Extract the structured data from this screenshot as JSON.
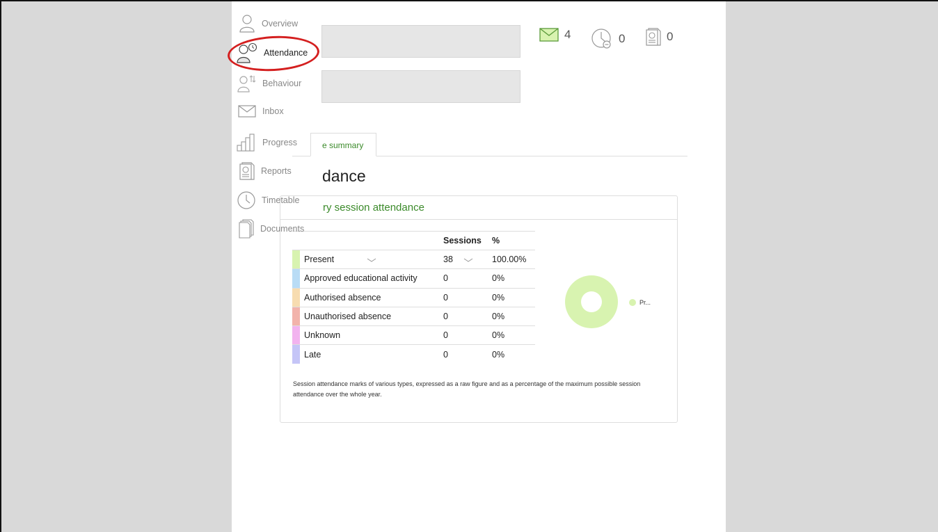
{
  "nav": {
    "items": [
      {
        "label": "Overview",
        "icon": "person-icon"
      },
      {
        "label": "Attendance",
        "icon": "person-clock-icon",
        "active": true
      },
      {
        "label": "Behaviour",
        "icon": "person-arrows-icon"
      },
      {
        "label": "Inbox",
        "icon": "envelope-icon"
      },
      {
        "label": "Progress",
        "icon": "bar-chart-icon"
      },
      {
        "label": "Reports",
        "icon": "report-icon"
      },
      {
        "label": "Timetable",
        "icon": "clock-icon"
      },
      {
        "label": "Documents",
        "icon": "documents-icon"
      }
    ]
  },
  "counters": {
    "messages": "4",
    "pending": "0",
    "reports": "0"
  },
  "tabs": {
    "active": "e summary"
  },
  "main": {
    "heading": "dance",
    "panel_title": "ry session attendance"
  },
  "table": {
    "headers": {
      "name": "",
      "sessions": "Sessions",
      "percent": "%"
    },
    "rows": [
      {
        "name": "Present",
        "sessions": "38",
        "percent": "100.00%",
        "color": "#d8f3b0"
      },
      {
        "name": "Approved educational activity",
        "sessions": "0",
        "percent": "0%",
        "color": "#b9dcf5"
      },
      {
        "name": "Authorised absence",
        "sessions": "0",
        "percent": "0%",
        "color": "#f7dcb0"
      },
      {
        "name": "Unauthorised absence",
        "sessions": "0",
        "percent": "0%",
        "color": "#f2b3ab"
      },
      {
        "name": "Unknown",
        "sessions": "0",
        "percent": "0%",
        "color": "#f2b3ef"
      },
      {
        "name": "Late",
        "sessions": "0",
        "percent": "0%",
        "color": "#c5c5f7"
      }
    ]
  },
  "footnote": "Session attendance marks of various types, expressed as a raw figure and as a percentage of the maximum possible session attendance over the whole year.",
  "chart": {
    "legend_label": "Pr...",
    "color": "#d8f3b0"
  }
}
